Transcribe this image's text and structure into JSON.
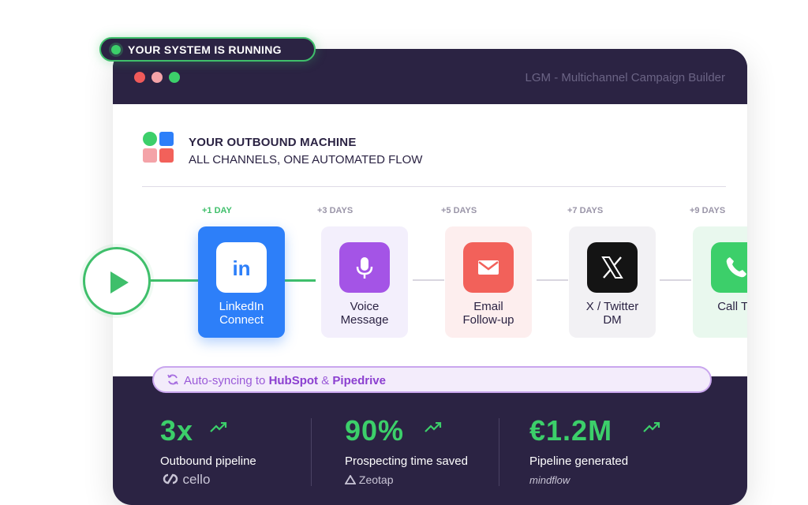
{
  "badge": {
    "text": "YOUR SYSTEM IS RUNNING"
  },
  "window": {
    "title": "LGM - Multichannel Campaign Builder"
  },
  "header": {
    "title": "YOUR OUTBOUND MACHINE",
    "subtitle": "ALL CHANNELS, ONE AUTOMATED FLOW"
  },
  "steps": [
    {
      "day": "+1 DAY",
      "label_line1": "LinkedIn",
      "label_line2": "Connect",
      "icon": "linkedin-icon"
    },
    {
      "day": "+3 DAYS",
      "label_line1": "Voice",
      "label_line2": "Message",
      "icon": "microphone-icon"
    },
    {
      "day": "+5 DAYS",
      "label_line1": "Email",
      "label_line2": "Follow-up",
      "icon": "envelope-icon"
    },
    {
      "day": "+7 DAYS",
      "label_line1": "X / Twitter",
      "label_line2": "DM",
      "icon": "x-icon"
    },
    {
      "day": "+9 DAYS",
      "label_line1": "Call Ta",
      "label_line2": "",
      "icon": "phone-icon"
    }
  ],
  "sync": {
    "prefix": "Auto-syncing to ",
    "crm1": "HubSpot",
    "joiner": " & ",
    "crm2": "Pipedrive"
  },
  "stats": [
    {
      "value": "3x",
      "label": "Outbound pipeline",
      "brand": "cello"
    },
    {
      "value": "90%",
      "label": "Prospecting time saved",
      "brand": "Zeotap"
    },
    {
      "value": "€1.2M",
      "label": "Pipeline generated",
      "brand": "mindflow"
    }
  ],
  "colors": {
    "accent_green": "#3ccf6a",
    "linkedin_blue": "#2d7ff9",
    "voice_purple": "#a454e6",
    "email_red": "#f2615a",
    "x_black": "#141414",
    "call_green": "#3ccf6a",
    "dark_bg": "#2b2343"
  }
}
